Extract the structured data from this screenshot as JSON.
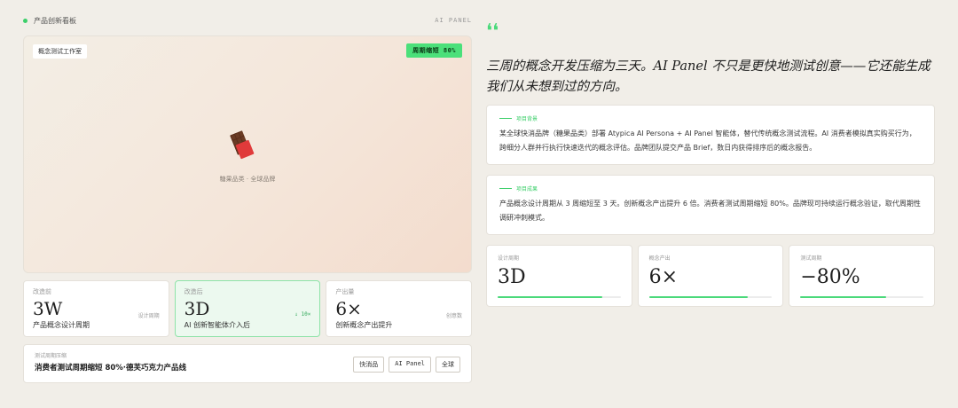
{
  "left": {
    "header": {
      "title": "产品创新看板",
      "tag": "AI PANEL"
    },
    "hero": {
      "chip": "概念测试工作室",
      "badge": "周期缩短 80%",
      "caption": "糖果品类 · 全球品牌"
    },
    "stats": [
      {
        "label": "改造前",
        "value": "3W",
        "side": "设计周期",
        "desc": "产品概念设计周期"
      },
      {
        "label": "改造后",
        "value": "3D",
        "side": "↓ 10×",
        "desc": "AI 创新智能体介入后"
      },
      {
        "label": "产出量",
        "value": "6×",
        "side": "创意数",
        "desc": "创新概念产出提升"
      }
    ],
    "footer": {
      "label": "测试周期压缩",
      "title": "消费者测试周期缩短 80%·德芙巧克力产品线",
      "pills": [
        "快消品",
        "AI Panel",
        "全球"
      ]
    }
  },
  "right": {
    "quote_mark": "❛❛",
    "quote": "三周的概念开发压缩为三天。AI Panel 不只是更快地测试创意——它还能生成我们从未想到过的方向。",
    "cards": [
      {
        "heading": "项目背景",
        "body": "某全球快消品牌（糖果品类）部署 Atypica AI Persona + AI Panel 智能体，替代传统概念测试流程。AI 消费者模拟真实购买行为，跨细分人群并行执行快速迭代的概念评估。品牌团队提交产品 Brief，数日内获得排序后的概念报告。"
      },
      {
        "heading": "项目成果",
        "body": "产品概念设计周期从 3 周缩短至 3 天。创新概念产出提升 6 倍。消费者测试周期缩短 80%。品牌现可持续运行概念验证，取代周期性调研冲刺模式。"
      }
    ],
    "metrics": [
      {
        "label": "设计周期",
        "value": "3D",
        "progress": 0.85
      },
      {
        "label": "概念产出",
        "value": "6×",
        "progress": 0.8
      },
      {
        "label": "测试周期",
        "value": "−80%",
        "progress": 0.7
      }
    ]
  },
  "colors": {
    "accent": "#4ad97a",
    "background": "#f1eee8",
    "badge": "#4be07a"
  }
}
